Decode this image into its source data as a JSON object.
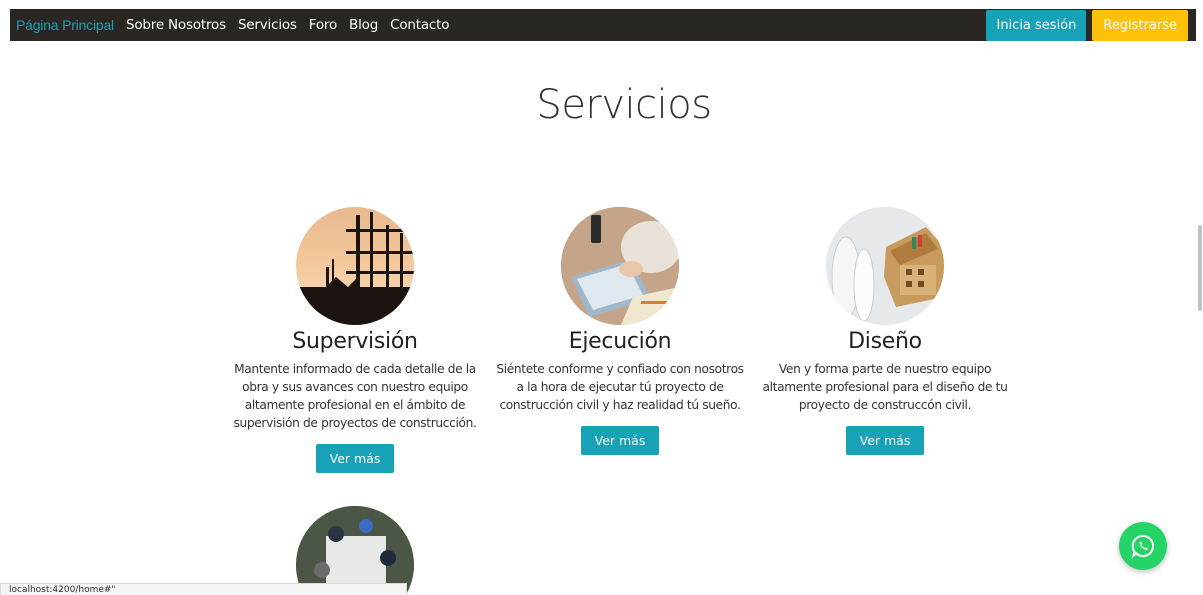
{
  "nav": {
    "links": [
      {
        "label": "Página Principal",
        "active": true
      },
      {
        "label": "Sobre Nosotros",
        "active": false
      },
      {
        "label": "Servicios",
        "active": false
      },
      {
        "label": "Foro",
        "active": false
      },
      {
        "label": "Blog",
        "active": false
      },
      {
        "label": "Contacto",
        "active": false
      }
    ],
    "login_label": "Inicia sesión",
    "register_label": "Registrarse"
  },
  "section": {
    "title": "Servicios"
  },
  "cards": [
    {
      "title": "Supervisión",
      "text": "Mantente informado de cada detalle de la obra y sus avances con nuestro equipo altamente profesional en el ámbito de supervisión de proyectos de construcción.",
      "button": "Ver más",
      "image_icon": "construction-silhouette-image"
    },
    {
      "title": "Ejecución",
      "text": "Siéntete conforme y confiado con nosotros a la hora de ejecutar tú proyecto de construcción civil y haz realidad tú sueño.",
      "button": "Ver más",
      "image_icon": "laptop-work-image"
    },
    {
      "title": "Diseño",
      "text": "Ven y forma parte de nuestro equipo altamente profesional para el diseño de tu proyecto de construccón civil.",
      "button": "Ver más",
      "image_icon": "blueprint-model-image"
    }
  ],
  "status_bar": {
    "url": "localhost:4200/home#\""
  },
  "colors": {
    "navbar_bg": "#2a2622",
    "accent": "#17a2b8",
    "warning": "#ffc107",
    "whatsapp": "#25d366"
  }
}
